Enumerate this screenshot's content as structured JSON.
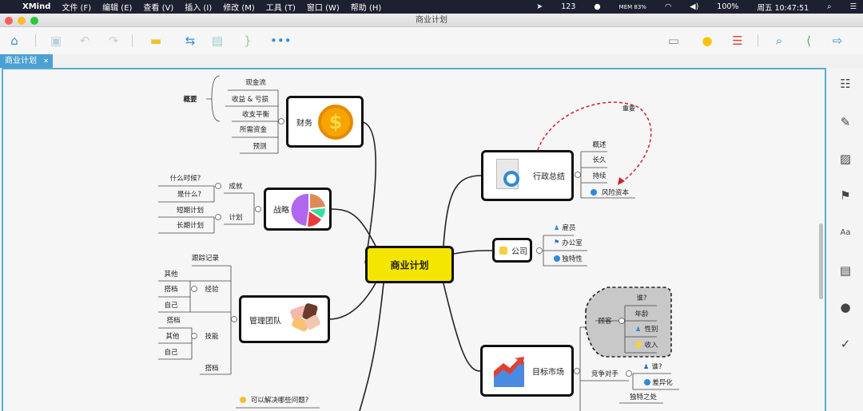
{
  "menubar": {
    "app": "XMind",
    "items": [
      "文件 (F)",
      "编辑 (E)",
      "查看 (V)",
      "插入 (I)",
      "修改 (M)",
      "工具 (T)",
      "窗口 (W)",
      "帮助 (H)"
    ],
    "status": {
      "badge": "123",
      "mem": "MEM 83%",
      "battery": "100%",
      "clock": "周五 10:47:51"
    }
  },
  "window": {
    "title": "商业计划"
  },
  "tab": {
    "label": "商业计划",
    "close": "✕"
  },
  "map": {
    "central": "商业计划",
    "finance": {
      "label": "财务",
      "summary": "概要",
      "children": [
        "现金流",
        "收益 & 亏损",
        "收支平衡",
        "所需资金",
        "预测"
      ]
    },
    "strategy": {
      "label": "战略",
      "a": "成就",
      "a_children": [
        "什么时候?",
        "是什么?"
      ],
      "b": "计划",
      "b_children": [
        "短期计划",
        "长期计划"
      ]
    },
    "team": {
      "label": "管理团队",
      "track": "跟踪记录",
      "exp": "经验",
      "exp_children": [
        "其他",
        "搭档",
        "自己"
      ],
      "skill": "技能",
      "skill_children": [
        "搭档",
        "其他",
        "自己"
      ],
      "partner": "搭档"
    },
    "bottom": {
      "label": "可以解决哪些问题?"
    },
    "exec": {
      "label": "行政总结",
      "children": [
        "概述",
        "长久",
        "持续",
        "风险资本"
      ],
      "relation": "重要"
    },
    "company": {
      "label": "公司",
      "children": [
        "雇员",
        "办公室",
        "独特性"
      ]
    },
    "market": {
      "label": "目标市场",
      "customer": "顾客",
      "customer_children": [
        "谁?",
        "年龄",
        "性别",
        "收入"
      ],
      "competitor": "竞争对手",
      "competitor_children": [
        "谁?",
        "差异化"
      ],
      "unique": "独特之处"
    }
  },
  "colors": {
    "central": "#f5e600",
    "accent": "#4aa0d2",
    "relation": "#d0202a"
  }
}
